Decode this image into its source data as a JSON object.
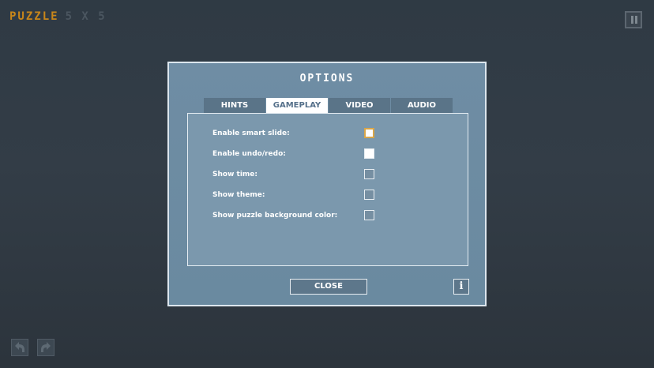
{
  "header": {
    "title_word": "PUZZLE",
    "title_size": "5 X 5",
    "pause_icon": "pause-icon"
  },
  "dialog": {
    "title": "OPTIONS",
    "tabs": [
      {
        "label": "HINTS",
        "active": false
      },
      {
        "label": "GAMEPLAY",
        "active": true
      },
      {
        "label": "VIDEO",
        "active": false
      },
      {
        "label": "AUDIO",
        "active": false
      }
    ],
    "options": [
      {
        "label": "Enable smart slide:",
        "checked": false,
        "focused": true
      },
      {
        "label": "Enable undo/redo:",
        "checked": true,
        "focused": false
      },
      {
        "label": "Show time:",
        "checked": false,
        "focused": false
      },
      {
        "label": "Show theme:",
        "checked": false,
        "focused": false
      },
      {
        "label": "Show puzzle background color:",
        "checked": false,
        "focused": false
      }
    ],
    "close_label": "CLOSE",
    "info_label": "i"
  },
  "footer": {
    "undo_icon": "undo-arrow-icon",
    "redo_icon": "redo-arrow-icon"
  },
  "colors": {
    "accent": "#c8861a",
    "dialog_bg": "#6f8da4",
    "tab_active_text": "#55708a"
  }
}
